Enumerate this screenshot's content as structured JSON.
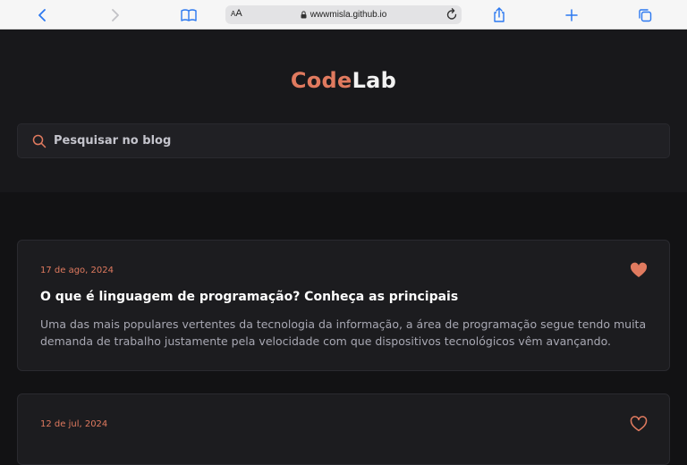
{
  "browser": {
    "text_size_label_small": "A",
    "text_size_label_large": "A",
    "url": "wwwmisla.github.io",
    "icons": [
      "back-icon",
      "forward-icon",
      "bookmarks-icon",
      "lock-icon",
      "reload-icon",
      "share-icon",
      "new-tab-icon",
      "tabs-icon"
    ]
  },
  "site": {
    "logo_part1": "Code",
    "logo_part2": "Lab",
    "search_placeholder": "Pesquisar no blog",
    "accent_color": "#e07a5f"
  },
  "posts": [
    {
      "date": "17 de ago, 2024",
      "title": "O que é linguagem de programação? Conheça as principais",
      "excerpt": "Uma das mais populares vertentes da tecnologia da informação, a área de programação segue tendo muita demanda de trabalho justamente pela velocidade com que dispositivos tecnológicos vêm avançando.",
      "liked": true
    },
    {
      "date": "12 de jul, 2024",
      "liked": false
    }
  ]
}
